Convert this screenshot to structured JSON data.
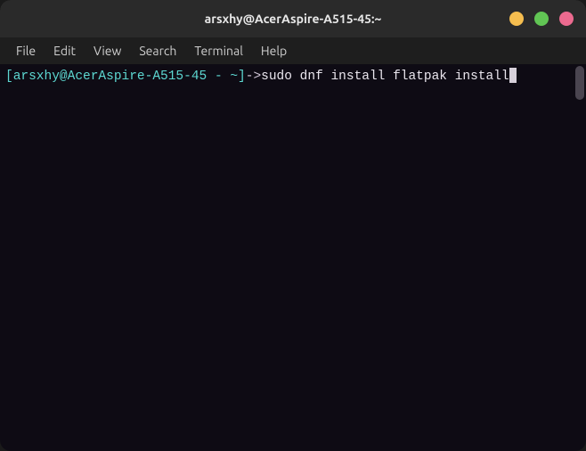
{
  "window": {
    "title": "arsxhy@AcerAspire-A515-45:~"
  },
  "menu": {
    "items": [
      "File",
      "Edit",
      "View",
      "Search",
      "Terminal",
      "Help"
    ]
  },
  "terminal": {
    "prompt": "[arsxhy@AcerAspire-A515-45 - ~]",
    "arrow": "->",
    "command": "sudo dnf install flatpak install"
  },
  "colors": {
    "prompt": "#5dd7d1",
    "background": "#0e0b14",
    "titlebar": "#2a2a2a"
  }
}
